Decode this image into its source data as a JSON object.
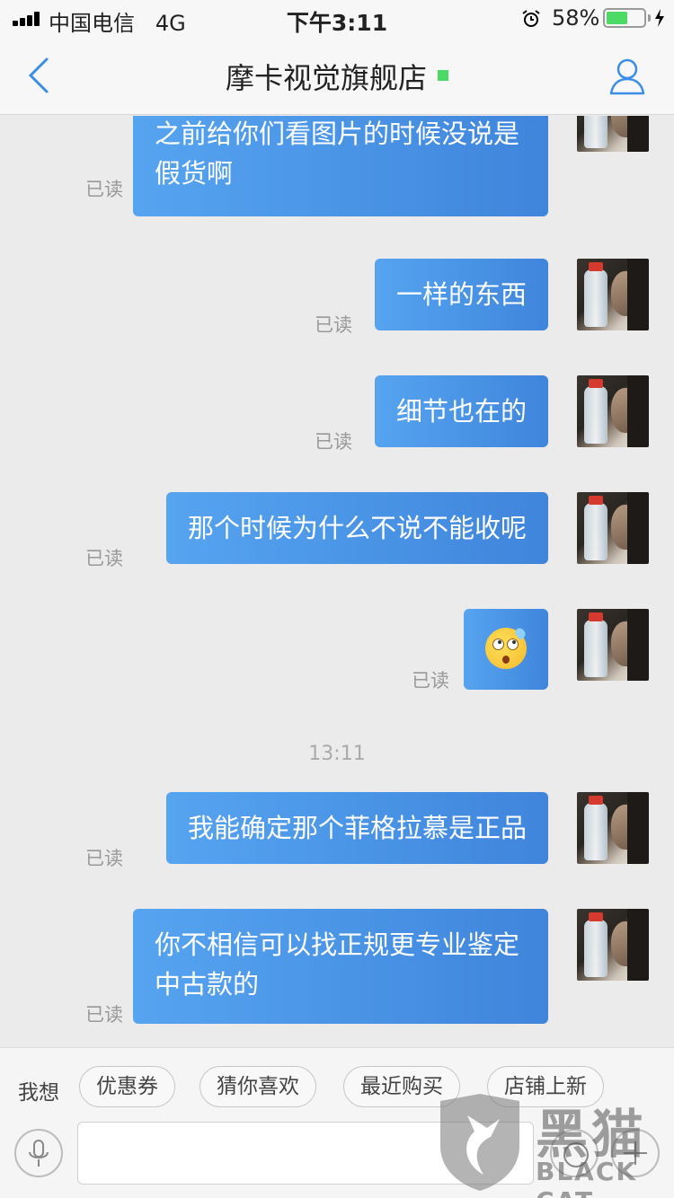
{
  "status_bar": {
    "carrier": "中国电信",
    "network": "4G",
    "time": "下午3:11",
    "battery_percent": "58%",
    "battery_level": 0.58
  },
  "header": {
    "title": "摩卡视觉旗舰店"
  },
  "messages": [
    {
      "text": "之前给你们看图片的时候没说是假货啊",
      "status": "已读"
    },
    {
      "text": "一样的东西",
      "status": "已读"
    },
    {
      "text": "细节也在的",
      "status": "已读"
    },
    {
      "text": "那个时候为什么不说不能收呢",
      "status": "已读"
    },
    {
      "text": "",
      "emoji": "rolling-eyes-emoji",
      "status": "已读"
    },
    {
      "text": "我能确定那个菲格拉慕是正品",
      "status": "已读"
    },
    {
      "text": "你不相信可以找正规更专业鉴定中古款的",
      "status": "已读"
    }
  ],
  "timestamp": "13:11",
  "quick_replies": {
    "label": "我想",
    "chips": [
      "优惠券",
      "猜你喜欢",
      "最近购买",
      "店铺上新"
    ]
  },
  "input": {
    "placeholder": ""
  },
  "watermark": {
    "cn": "黑猫",
    "en": "BLACK CAT"
  },
  "colors": {
    "bubble": "#4a94e6",
    "online": "#4cd964",
    "accent": "#3b8ee8"
  }
}
